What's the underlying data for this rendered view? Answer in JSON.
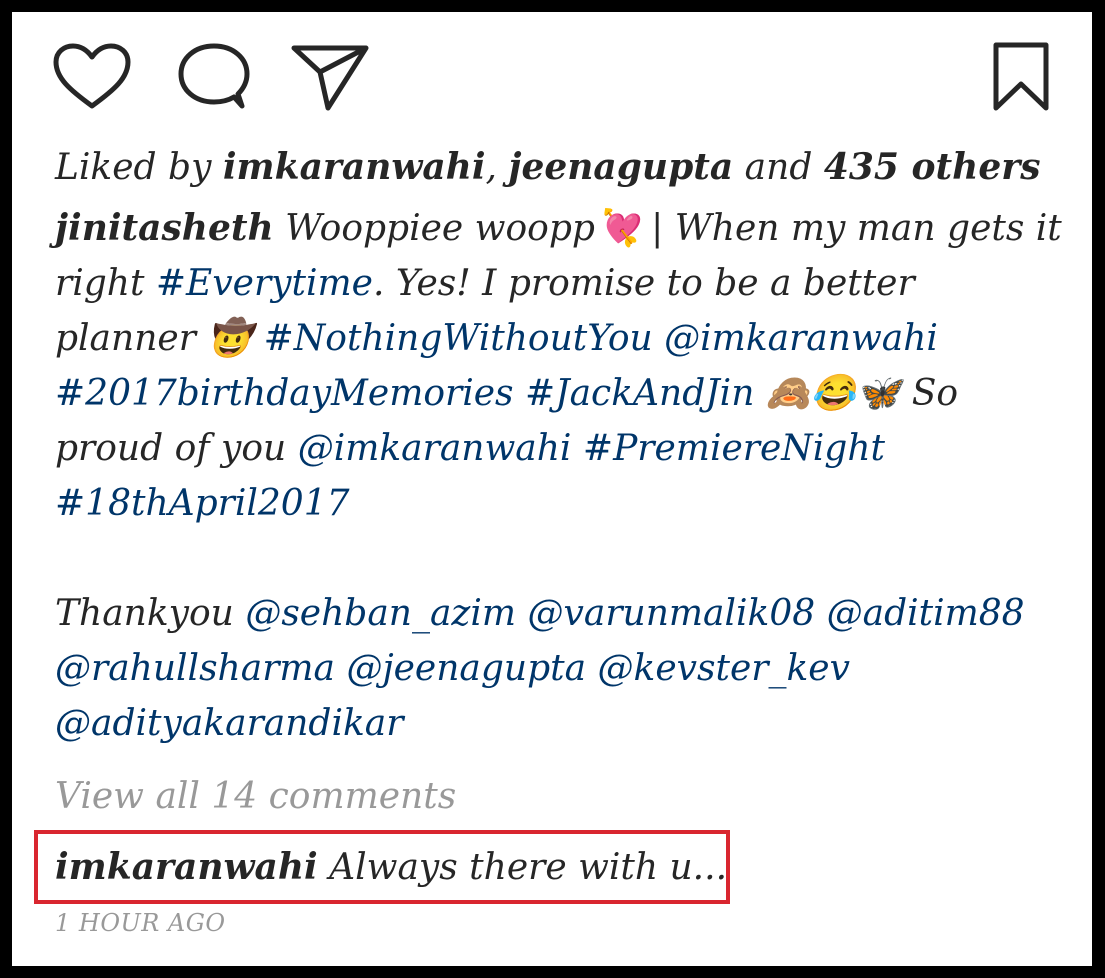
{
  "icons": {
    "like": "heart-icon",
    "comment": "comment-bubble-icon",
    "share": "paper-plane-icon",
    "save": "bookmark-icon"
  },
  "likes": {
    "prefix": "Liked by ",
    "user1": "imkaranwahi",
    "separator": ", ",
    "user2": "jeenagupta",
    "and": " and ",
    "others": "435 others"
  },
  "caption": {
    "username": "jinitasheth",
    "line1_text": " Wooppiee woopp💘 | When my man gets it right ",
    "tag_everytime": "#Everytime",
    "text_yes": ". Yes! I promise to be a better planner 🤠 ",
    "tag_nothing": "#NothingWithoutYou",
    "mention_karan1": "@imkaranwahi",
    "tag_birthday": "#2017birthdayMemories",
    "tag_jack": "#JackAndJin",
    "text_emoji": " 🙈😂🦋 So proud of you ",
    "mention_karan2": "@imkaranwahi",
    "tag_premiere": "#PremiereNight",
    "tag_date": "#18thApril2017",
    "thanks": "Thankyou ",
    "mention_sehban": "@sehban_azim",
    "mention_varun": "@varunmalik08",
    "mention_aditi": "@aditim88",
    "mention_rahul": "@rahullsharma",
    "mention_jeena": "@jeenagupta",
    "mention_kev": "@kevster_kev",
    "mention_aditya": "@adityakarandikar"
  },
  "view_all_comments": "View all 14 comments",
  "comment": {
    "username": "imkaranwahi",
    "text": " Always there with u..."
  },
  "timestamp": "1 HOUR AGO",
  "colors": {
    "hashtag": "#003569",
    "muted": "#999999",
    "highlight_border": "#d9262f"
  }
}
